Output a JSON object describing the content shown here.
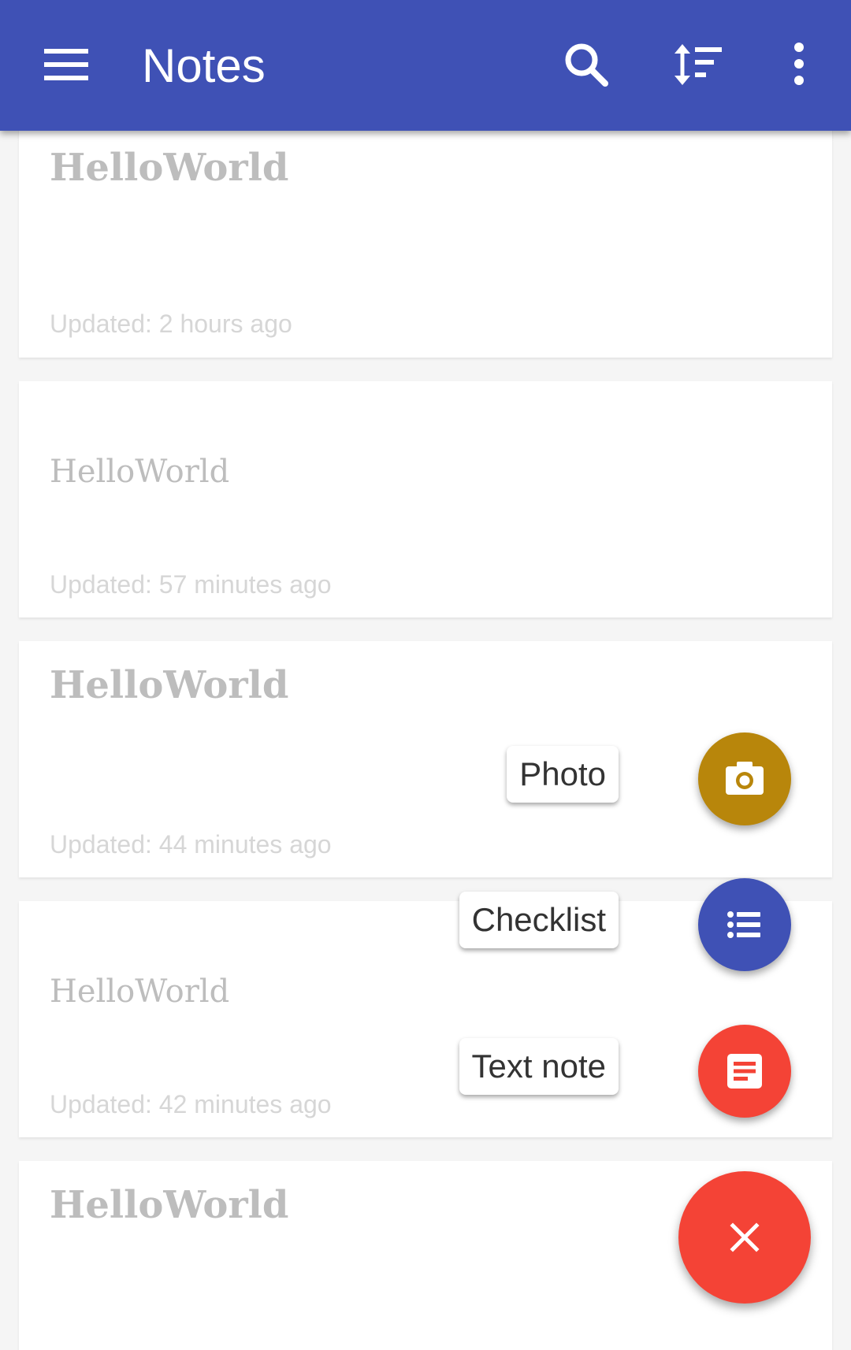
{
  "appbar": {
    "title": "Notes",
    "color": "#3f51b5",
    "icons": [
      "menu-icon",
      "search-icon",
      "sort-icon",
      "more-vert-icon"
    ]
  },
  "notes": [
    {
      "title": "HelloWorld",
      "title_style": "bold",
      "updated": "Updated: 2 hours ago"
    },
    {
      "title": "HelloWorld",
      "title_style": "regular",
      "updated": "Updated: 57 minutes ago"
    },
    {
      "title": "HelloWorld",
      "title_style": "bold",
      "updated": "Updated: 44 minutes ago"
    },
    {
      "title": "HelloWorld",
      "title_style": "regular",
      "updated": "Updated: 42 minutes ago"
    },
    {
      "title": "HelloWorld",
      "title_style": "bold",
      "updated": ""
    }
  ],
  "fab_menu": {
    "photo": {
      "label": "Photo",
      "color": "#b8860b",
      "icon": "camera-icon"
    },
    "checklist": {
      "label": "Checklist",
      "color": "#3f51b5",
      "icon": "list-icon"
    },
    "text_note": {
      "label": "Text note",
      "color": "#f44336",
      "icon": "text-note-icon"
    },
    "close": {
      "color": "#f44336",
      "icon": "close-icon"
    }
  }
}
